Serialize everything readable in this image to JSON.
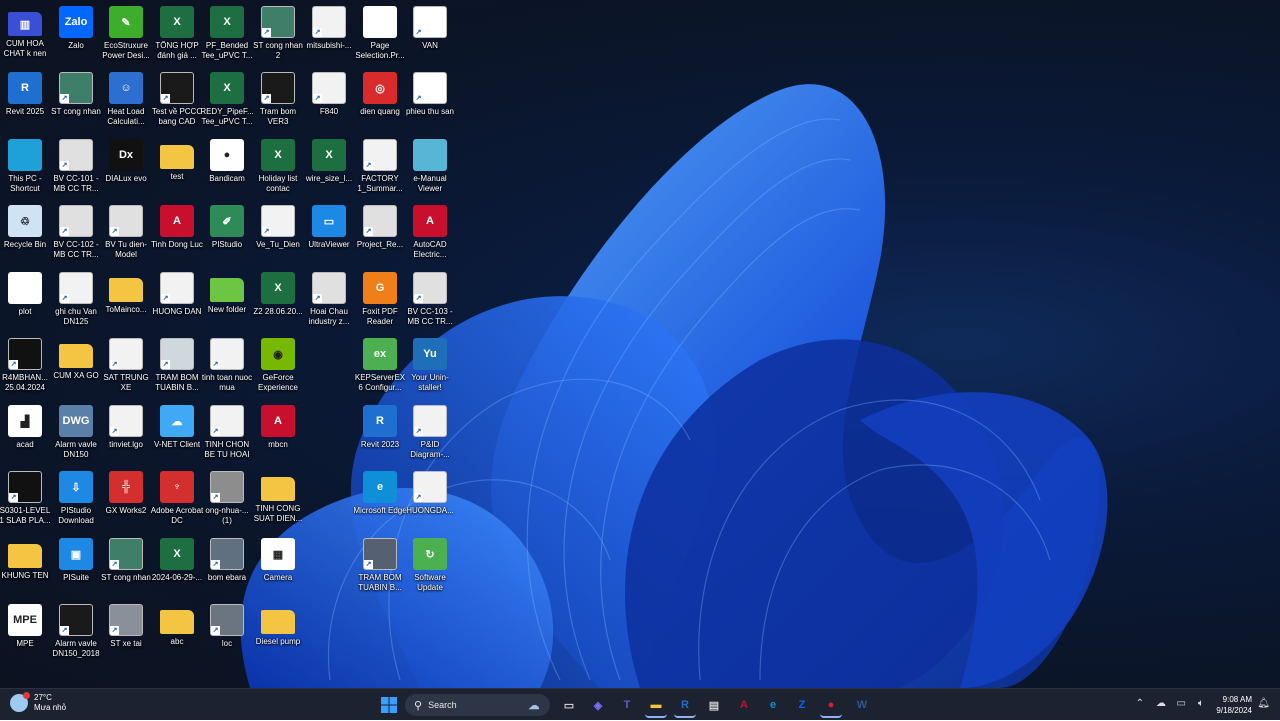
{
  "desktop": {
    "icons": [
      {
        "label": "CUM HOA CHAT k nen",
        "icon": "folder-archive-icon",
        "color": "#3b4fd6",
        "glyph": "▥"
      },
      {
        "label": "Zalo",
        "icon": "zalo-icon",
        "color": "#0068ff",
        "glyph": "Zalo"
      },
      {
        "label": "EcoStruxure Power Desi...",
        "icon": "ecostruxure-icon",
        "color": "#3dae2b",
        "glyph": "✎"
      },
      {
        "label": "TỔNG HỢP đánh giá ...",
        "icon": "excel-icon",
        "color": "#1d6f42",
        "glyph": "X"
      },
      {
        "label": "PF_Bended Tee_uPVC T...",
        "icon": "excel-icon",
        "color": "#1d6f42",
        "glyph": "X"
      },
      {
        "label": "ST cong nhan 2",
        "icon": "image-thumbnail-icon",
        "color": "#3f7f6a",
        "glyph": ""
      },
      {
        "label": "mitsubishi-...",
        "icon": "document-thumbnail-icon",
        "color": "#f2f2f2",
        "glyph": ""
      },
      {
        "label": "Page Selection.Pr...",
        "icon": "file-icon",
        "color": "#ffffff",
        "glyph": ""
      },
      {
        "label": "VAN",
        "icon": "image-thumbnail-icon",
        "color": "#ffffff",
        "glyph": ""
      },
      {
        "label": "Revit 2025",
        "icon": "revit-icon",
        "color": "#1f6fd1",
        "glyph": "R"
      },
      {
        "label": "ST cong nhan",
        "icon": "image-thumbnail-icon",
        "color": "#3f7f6a",
        "glyph": ""
      },
      {
        "label": "Heat Load Calculati...",
        "icon": "heat-load-icon",
        "color": "#2d6fd1",
        "glyph": "☺"
      },
      {
        "label": "Test về PCCC bang CAD",
        "icon": "cad-thumbnail-icon",
        "color": "#1a1a1a",
        "glyph": ""
      },
      {
        "label": "REDY_PipeF... Tee_uPVC T...",
        "icon": "excel-icon",
        "color": "#1d6f42",
        "glyph": "X"
      },
      {
        "label": "Tram bom VER3",
        "icon": "cad-thumbnail-icon",
        "color": "#1a1a1a",
        "glyph": ""
      },
      {
        "label": "F840",
        "icon": "document-thumbnail-icon",
        "color": "#f2f2f2",
        "glyph": ""
      },
      {
        "label": "dien quang",
        "icon": "dien-quang-icon",
        "color": "#d92b2b",
        "glyph": "◎"
      },
      {
        "label": "phieu thu san",
        "icon": "image-thumbnail-icon",
        "color": "#ffffff",
        "glyph": ""
      },
      {
        "label": "This PC - Shortcut",
        "icon": "this-pc-icon",
        "color": "#1ea0d8",
        "glyph": ""
      },
      {
        "label": "BV CC-101 - MB CC TR...",
        "icon": "cad-thumbnail-icon",
        "color": "#e0e0e0",
        "glyph": ""
      },
      {
        "label": "DIALux evo",
        "icon": "dialux-icon",
        "color": "#111111",
        "glyph": "Dx"
      },
      {
        "label": "test",
        "icon": "folder-icon",
        "color": "#f4c542",
        "glyph": ""
      },
      {
        "label": "Bandicam",
        "icon": "bandicam-icon",
        "color": "#ffffff",
        "glyph": "●"
      },
      {
        "label": "Holiday list contac",
        "icon": "excel-icon",
        "color": "#1d6f42",
        "glyph": "X"
      },
      {
        "label": "wire_size_l...",
        "icon": "excel-icon",
        "color": "#1d6f42",
        "glyph": "X"
      },
      {
        "label": "FACTORY 1_Summar...",
        "icon": "document-thumbnail-icon",
        "color": "#f2f2f2",
        "glyph": ""
      },
      {
        "label": "e-Manual Viewer",
        "icon": "e-manual-icon",
        "color": "#57b6d6",
        "glyph": ""
      },
      {
        "label": "Recycle Bin",
        "icon": "recycle-bin-icon",
        "color": "#cfe3f5",
        "glyph": "♲"
      },
      {
        "label": "BV CC-102 - MB CC TR...",
        "icon": "cad-thumbnail-icon",
        "color": "#e0e0e0",
        "glyph": ""
      },
      {
        "label": "BV Tu dien-Model",
        "icon": "cad-thumbnail-icon",
        "color": "#e0e0e0",
        "glyph": ""
      },
      {
        "label": "Tinh Dong Luc",
        "icon": "autocad-dxf-icon",
        "color": "#c8102e",
        "glyph": "A"
      },
      {
        "label": "PIStudio",
        "icon": "pistudio-icon",
        "color": "#2e8b57",
        "glyph": "✐"
      },
      {
        "label": "Ve_Tu_Dien",
        "icon": "document-thumbnail-icon",
        "color": "#f2f2f2",
        "glyph": ""
      },
      {
        "label": "UltraViewer",
        "icon": "ultraviewer-icon",
        "color": "#1e88e5",
        "glyph": "▭"
      },
      {
        "label": "Project_Re...",
        "icon": "image-thumbnail-icon",
        "color": "#e0e0e0",
        "glyph": ""
      },
      {
        "label": "AutoCAD Electric...",
        "icon": "autocad-electrical-icon",
        "color": "#c8102e",
        "glyph": "A"
      },
      {
        "label": "plot",
        "icon": "file-icon",
        "color": "#ffffff",
        "glyph": ""
      },
      {
        "label": "ghi chu Van DN125",
        "icon": "image-thumbnail-icon",
        "color": "#f2f2f2",
        "glyph": ""
      },
      {
        "label": "ToMainco...",
        "icon": "folder-icon",
        "color": "#f4c542",
        "glyph": ""
      },
      {
        "label": "HUONG DAN",
        "icon": "image-thumbnail-icon",
        "color": "#f2f2f2",
        "glyph": ""
      },
      {
        "label": "New folder",
        "icon": "folder-icon",
        "color": "#6cc644",
        "glyph": ""
      },
      {
        "label": "Z2 28.06.20...",
        "icon": "excel-icon",
        "color": "#1d6f42",
        "glyph": "X"
      },
      {
        "label": "Hoai Chau industry z...",
        "icon": "image-thumbnail-icon",
        "color": "#e0e0e0",
        "glyph": ""
      },
      {
        "label": "Foxit PDF Reader",
        "icon": "foxit-icon",
        "color": "#f07f1a",
        "glyph": "G"
      },
      {
        "label": "BV CC-103 - MB CC TR...",
        "icon": "cad-thumbnail-icon",
        "color": "#e0e0e0",
        "glyph": ""
      },
      {
        "label": "R4MBHAN... 25.04.2024",
        "icon": "cad-thumbnail-icon",
        "color": "#111111",
        "glyph": ""
      },
      {
        "label": "CUM XA GO",
        "icon": "folder-icon",
        "color": "#f4c542",
        "glyph": ""
      },
      {
        "label": "SAT TRUNG XE",
        "icon": "image-thumbnail-icon",
        "color": "#f2f2f2",
        "glyph": ""
      },
      {
        "label": "TRAM BOM TUABIN B...",
        "icon": "image-thumbnail-icon",
        "color": "#cfd8dc",
        "glyph": ""
      },
      {
        "label": "tinh toan nuoc mua",
        "icon": "document-thumbnail-icon",
        "color": "#f2f2f2",
        "glyph": ""
      },
      {
        "label": "GeForce Experience",
        "icon": "geforce-icon",
        "color": "#76b900",
        "glyph": "◉"
      },
      {
        "label": "",
        "icon": "",
        "color": "",
        "glyph": ""
      },
      {
        "label": "KEPServerEX 6 Configur...",
        "icon": "kepserver-icon",
        "color": "#4caf50",
        "glyph": "ex"
      },
      {
        "label": "Your Unin-staller!",
        "icon": "uninstaller-icon",
        "color": "#1e6fb8",
        "glyph": "Yu"
      },
      {
        "label": "acad",
        "icon": "acad-icon",
        "color": "#ffffff",
        "glyph": "▟"
      },
      {
        "label": "Alarm vavle DN150",
        "icon": "dwg-icon",
        "color": "#5a7fa8",
        "glyph": "DWG"
      },
      {
        "label": "tinviet.lgo",
        "icon": "image-thumbnail-icon",
        "color": "#f2f2f2",
        "glyph": ""
      },
      {
        "label": "V-NET Client",
        "icon": "vnet-icon",
        "color": "#3fa9f5",
        "glyph": "☁"
      },
      {
        "label": "TINH CHON BE TU HOAI",
        "icon": "document-thumbnail-icon",
        "color": "#f2f2f2",
        "glyph": ""
      },
      {
        "label": "mbcn",
        "icon": "autocad-dxf-icon",
        "color": "#c8102e",
        "glyph": "A"
      },
      {
        "label": "",
        "icon": "",
        "color": "",
        "glyph": ""
      },
      {
        "label": "Revit 2023",
        "icon": "revit-icon",
        "color": "#1f6fd1",
        "glyph": "R"
      },
      {
        "label": "P&ID Diagram-...",
        "icon": "document-thumbnail-icon",
        "color": "#f2f2f2",
        "glyph": ""
      },
      {
        "label": "S0301-LEVEL 1 SLAB PLA...",
        "icon": "cad-thumbnail-icon",
        "color": "#111111",
        "glyph": ""
      },
      {
        "label": "PIStudio Download",
        "icon": "pistudio-download-icon",
        "color": "#1e88e5",
        "glyph": "⇩"
      },
      {
        "label": "GX Works2",
        "icon": "gx-works-icon",
        "color": "#d32f2f",
        "glyph": "╬"
      },
      {
        "label": "Adobe Acrobat DC",
        "icon": "acrobat-icon",
        "color": "#d32f2f",
        "glyph": "♆"
      },
      {
        "label": "ong-nhua-... (1)",
        "icon": "image-thumbnail-icon",
        "color": "#8d8d8d",
        "glyph": ""
      },
      {
        "label": "TINH CONG SUAT DIEN...",
        "icon": "folder-icon",
        "color": "#f4c542",
        "glyph": ""
      },
      {
        "label": "",
        "icon": "",
        "color": "",
        "glyph": ""
      },
      {
        "label": "Microsoft Edge",
        "icon": "edge-icon",
        "color": "#0f8fd8",
        "glyph": "e"
      },
      {
        "label": "HUONGDA...",
        "icon": "document-thumbnail-icon",
        "color": "#f2f2f2",
        "glyph": ""
      },
      {
        "label": "KHUNG TEN",
        "icon": "folder-icon",
        "color": "#f4c542",
        "glyph": ""
      },
      {
        "label": "PISuite",
        "icon": "pisuite-icon",
        "color": "#1e88e5",
        "glyph": "▣"
      },
      {
        "label": "ST cong nhan",
        "icon": "image-thumbnail-icon",
        "color": "#3f7f6a",
        "glyph": ""
      },
      {
        "label": "2024-06-29-...",
        "icon": "excel-icon",
        "color": "#1d6f42",
        "glyph": "X"
      },
      {
        "label": "bom ebara",
        "icon": "image-thumbnail-icon",
        "color": "#607080",
        "glyph": ""
      },
      {
        "label": "Camera",
        "icon": "qr-code-icon",
        "color": "#ffffff",
        "glyph": "▦"
      },
      {
        "label": "",
        "icon": "",
        "color": "",
        "glyph": ""
      },
      {
        "label": "TRAM BOM TUABIN B...",
        "icon": "image-thumbnail-icon",
        "color": "#556070",
        "glyph": ""
      },
      {
        "label": "Software Update",
        "icon": "software-update-icon",
        "color": "#4caf50",
        "glyph": "↻"
      },
      {
        "label": "MPE",
        "icon": "mpe-icon",
        "color": "#ffffff",
        "glyph": "MPE"
      },
      {
        "label": "Alarm vavle DN150_2018",
        "icon": "cad-thumbnail-icon",
        "color": "#1a1a1a",
        "glyph": ""
      },
      {
        "label": "ST xe tai",
        "icon": "image-thumbnail-icon",
        "color": "#8a9099",
        "glyph": ""
      },
      {
        "label": "abc",
        "icon": "folder-icon",
        "color": "#f4c542",
        "glyph": ""
      },
      {
        "label": "loc",
        "icon": "image-thumbnail-icon",
        "color": "#6a7580",
        "glyph": ""
      },
      {
        "label": "Diesel pump",
        "icon": "folder-icon",
        "color": "#f4c542",
        "glyph": ""
      },
      {
        "label": "",
        "icon": "",
        "color": "",
        "glyph": ""
      }
    ]
  },
  "taskbar": {
    "weather": {
      "temp": "27°C",
      "condition": "Mưa nhỏ",
      "icon": "weather-rain-icon"
    },
    "search_label": "Search",
    "pinned": [
      {
        "name": "start-button",
        "glyph": "⊞",
        "color": "#3aa0ff"
      },
      {
        "name": "widget-icon",
        "glyph": "☁",
        "color": "#9fc4e0"
      },
      {
        "name": "task-view-icon",
        "glyph": "▭",
        "color": "#d0d0d0"
      },
      {
        "name": "copilot-icon",
        "glyph": "◈",
        "color": "#7b6cf6"
      },
      {
        "name": "teams-icon",
        "glyph": "T",
        "color": "#5b5fc7"
      },
      {
        "name": "file-explorer-icon",
        "glyph": "▬",
        "color": "#f4c542"
      },
      {
        "name": "revit-taskbar-icon",
        "glyph": "R",
        "color": "#1f6fd1"
      },
      {
        "name": "store-icon",
        "glyph": "▤",
        "color": "#d0d0d0"
      },
      {
        "name": "autocad-taskbar-icon",
        "glyph": "A",
        "color": "#c8102e"
      },
      {
        "name": "edge-taskbar-icon",
        "glyph": "e",
        "color": "#0f8fd8"
      },
      {
        "name": "zalo-taskbar-icon",
        "glyph": "Z",
        "color": "#0068ff"
      },
      {
        "name": "bandicam-taskbar-icon",
        "glyph": "●",
        "color": "#e02020"
      },
      {
        "name": "word-taskbar-icon",
        "glyph": "W",
        "color": "#2b579a"
      }
    ],
    "time": "9:08 AM",
    "date": "9/18/2024"
  }
}
